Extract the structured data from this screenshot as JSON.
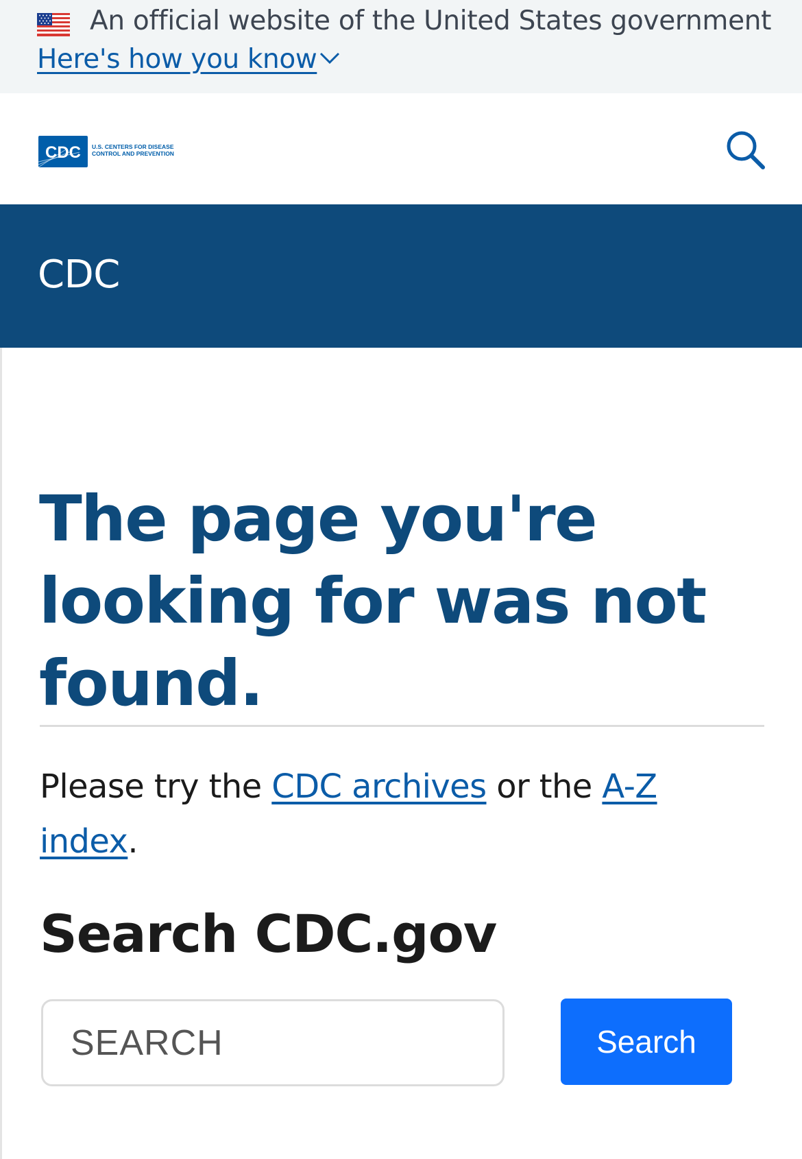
{
  "gov_banner": {
    "official_text": "An official website of the United States government",
    "how_you_know_label": "Here's how you know",
    "flag_icon": "us-flag-icon",
    "chevron_icon": "chevron-down-icon"
  },
  "header": {
    "logo_mark": "CDC",
    "logo_line1": "U.S. CENTERS FOR DISEASE",
    "logo_line2": "CONTROL AND PREVENTION",
    "search_icon": "search-icon"
  },
  "site_bar": {
    "title": "CDC"
  },
  "main": {
    "heading": "The page you're looking for was not found.",
    "try_prefix": "Please try the ",
    "archives_link": "CDC archives",
    "try_middle": " or the ",
    "az_link": "A-Z index",
    "try_suffix": ".",
    "search_heading": "Search CDC.gov",
    "search_placeholder": "SEARCH",
    "search_button": "Search"
  },
  "colors": {
    "banner_bg": "#f2f5f6",
    "brand_blue": "#0e4a7b",
    "link_blue": "#0b5ca8",
    "button_blue": "#0d6efd",
    "logo_blue": "#005eaa"
  }
}
